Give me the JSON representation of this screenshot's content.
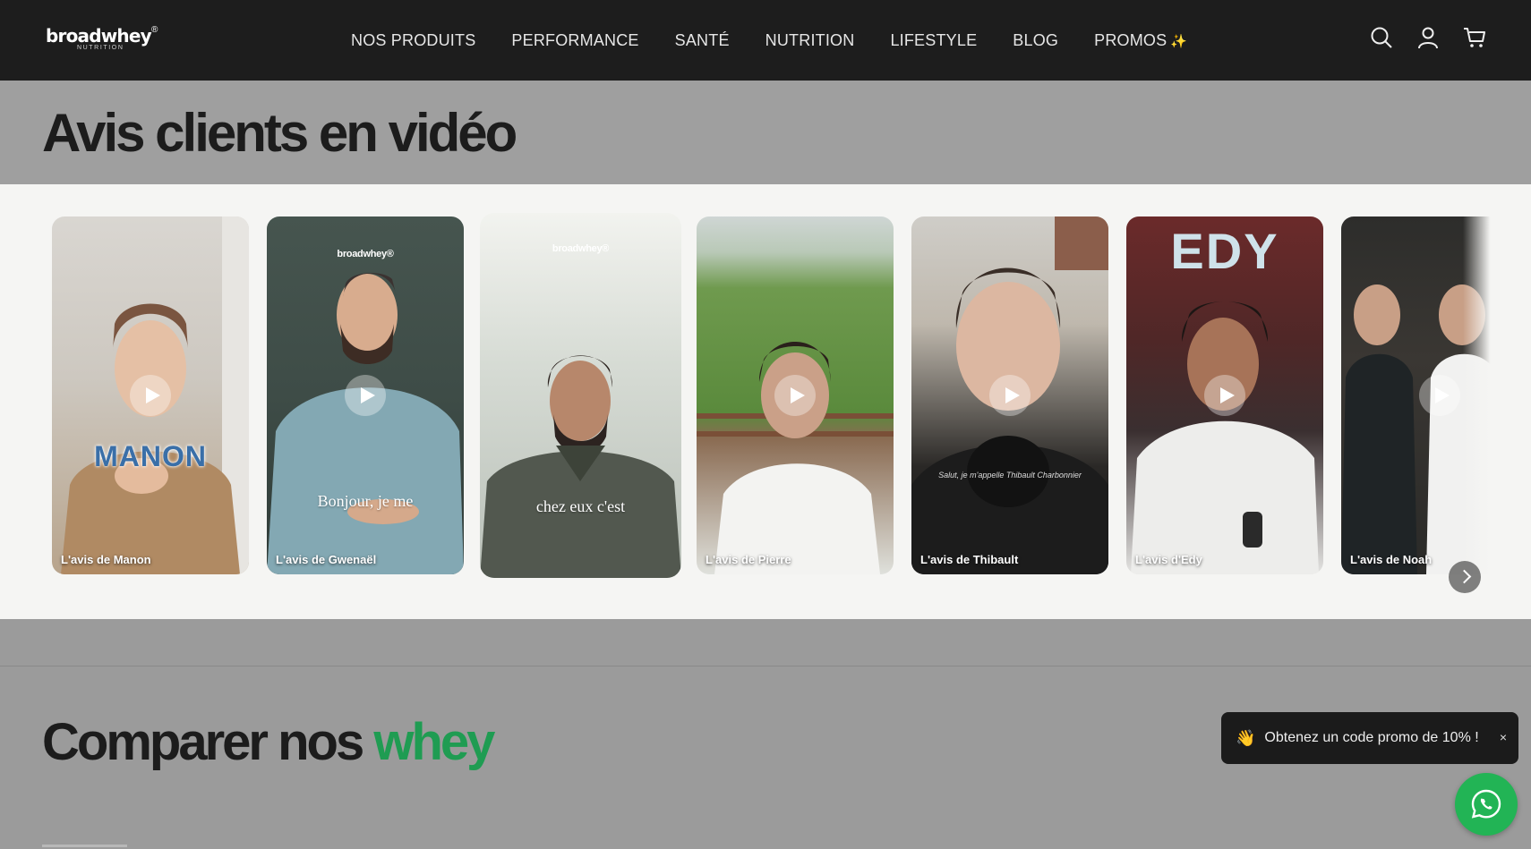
{
  "header": {
    "logo_word": "broadwhey",
    "logo_reg": "®",
    "logo_sub": "NUTRITION",
    "nav": [
      "NOS PRODUITS",
      "PERFORMANCE",
      "SANTÉ",
      "NUTRITION",
      "LIFESTYLE",
      "BLOG",
      "PROMOS"
    ],
    "promos_icon": "sparkles-icon",
    "icons": [
      "search-icon",
      "account-icon",
      "cart-icon"
    ]
  },
  "avis": {
    "title": "Avis clients en vidéo",
    "cards": [
      {
        "label": "L'avis de Manon",
        "overlay": "MANON"
      },
      {
        "label": "L'avis de Gwenaël",
        "overlay": "Bonjour, je me",
        "brand": "broadwhey®"
      },
      {
        "label": "",
        "overlay": "chez eux c'est",
        "brand": "broadwhey®"
      },
      {
        "label": "L'avis de Pierre"
      },
      {
        "label": "L'avis de Thibault",
        "caption": "Salut, je m'appelle Thibault Charbonnier"
      },
      {
        "label": "L'avis d'Edy",
        "overlay": "EDY"
      },
      {
        "label": "L'avis de Noah"
      }
    ]
  },
  "compare": {
    "title_main": "Comparer nos ",
    "title_accent": "whey",
    "accent_color": "#1f9c52"
  },
  "promo_popup": {
    "text": "Obtenez un code promo de 10% !",
    "close": "×"
  },
  "colors": {
    "header_bg": "#1d1d1d",
    "whatsapp": "#22b455"
  }
}
